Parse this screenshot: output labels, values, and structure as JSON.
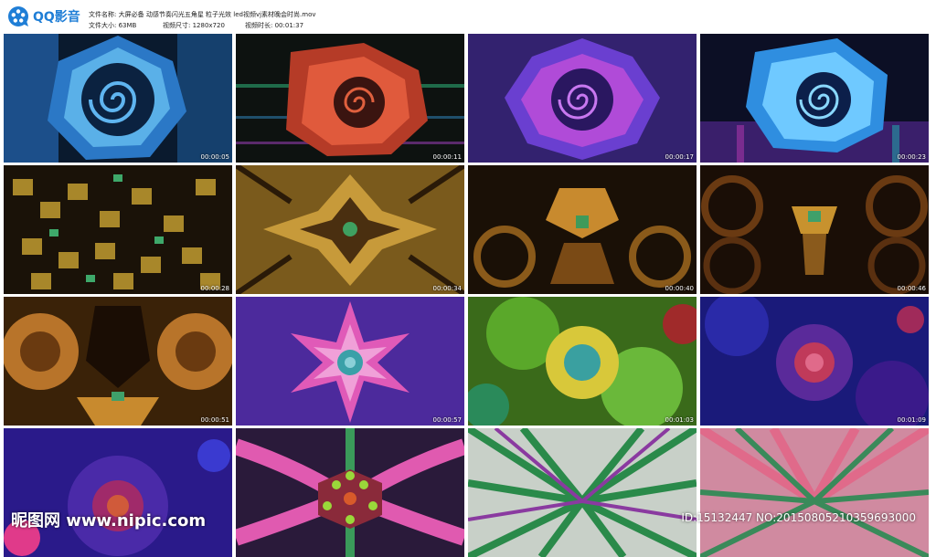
{
  "app": {
    "name": "QQ影音",
    "brand_color": "#1f7ed6"
  },
  "file_info": {
    "name_label": "文件名称:",
    "name_value": "大屏必备 动感节奏闪光五角星 粒子光效 led视频vj素材晚会时尚.mov",
    "size_label": "文件大小:",
    "size_value": "63MB",
    "dims_label": "视频尺寸:",
    "dims_value": "1280x720",
    "duration_label": "视频时长:",
    "duration_value": "00:01:37"
  },
  "thumbnails": [
    {
      "timestamp": "00:00:05"
    },
    {
      "timestamp": "00:00:11"
    },
    {
      "timestamp": "00:00:17"
    },
    {
      "timestamp": "00:00:23"
    },
    {
      "timestamp": "00:00:28"
    },
    {
      "timestamp": "00:00:34"
    },
    {
      "timestamp": "00:00:40"
    },
    {
      "timestamp": "00:00:46"
    },
    {
      "timestamp": "00:00:51"
    },
    {
      "timestamp": "00:00:57"
    },
    {
      "timestamp": "00:01:03"
    },
    {
      "timestamp": "00:01:09"
    },
    {
      "timestamp": ""
    },
    {
      "timestamp": ""
    },
    {
      "timestamp": ""
    },
    {
      "timestamp": ""
    }
  ],
  "watermark": {
    "left": "昵图网 www.nipic.com",
    "right": "ID:15132447 NO:20150805210359693000"
  }
}
